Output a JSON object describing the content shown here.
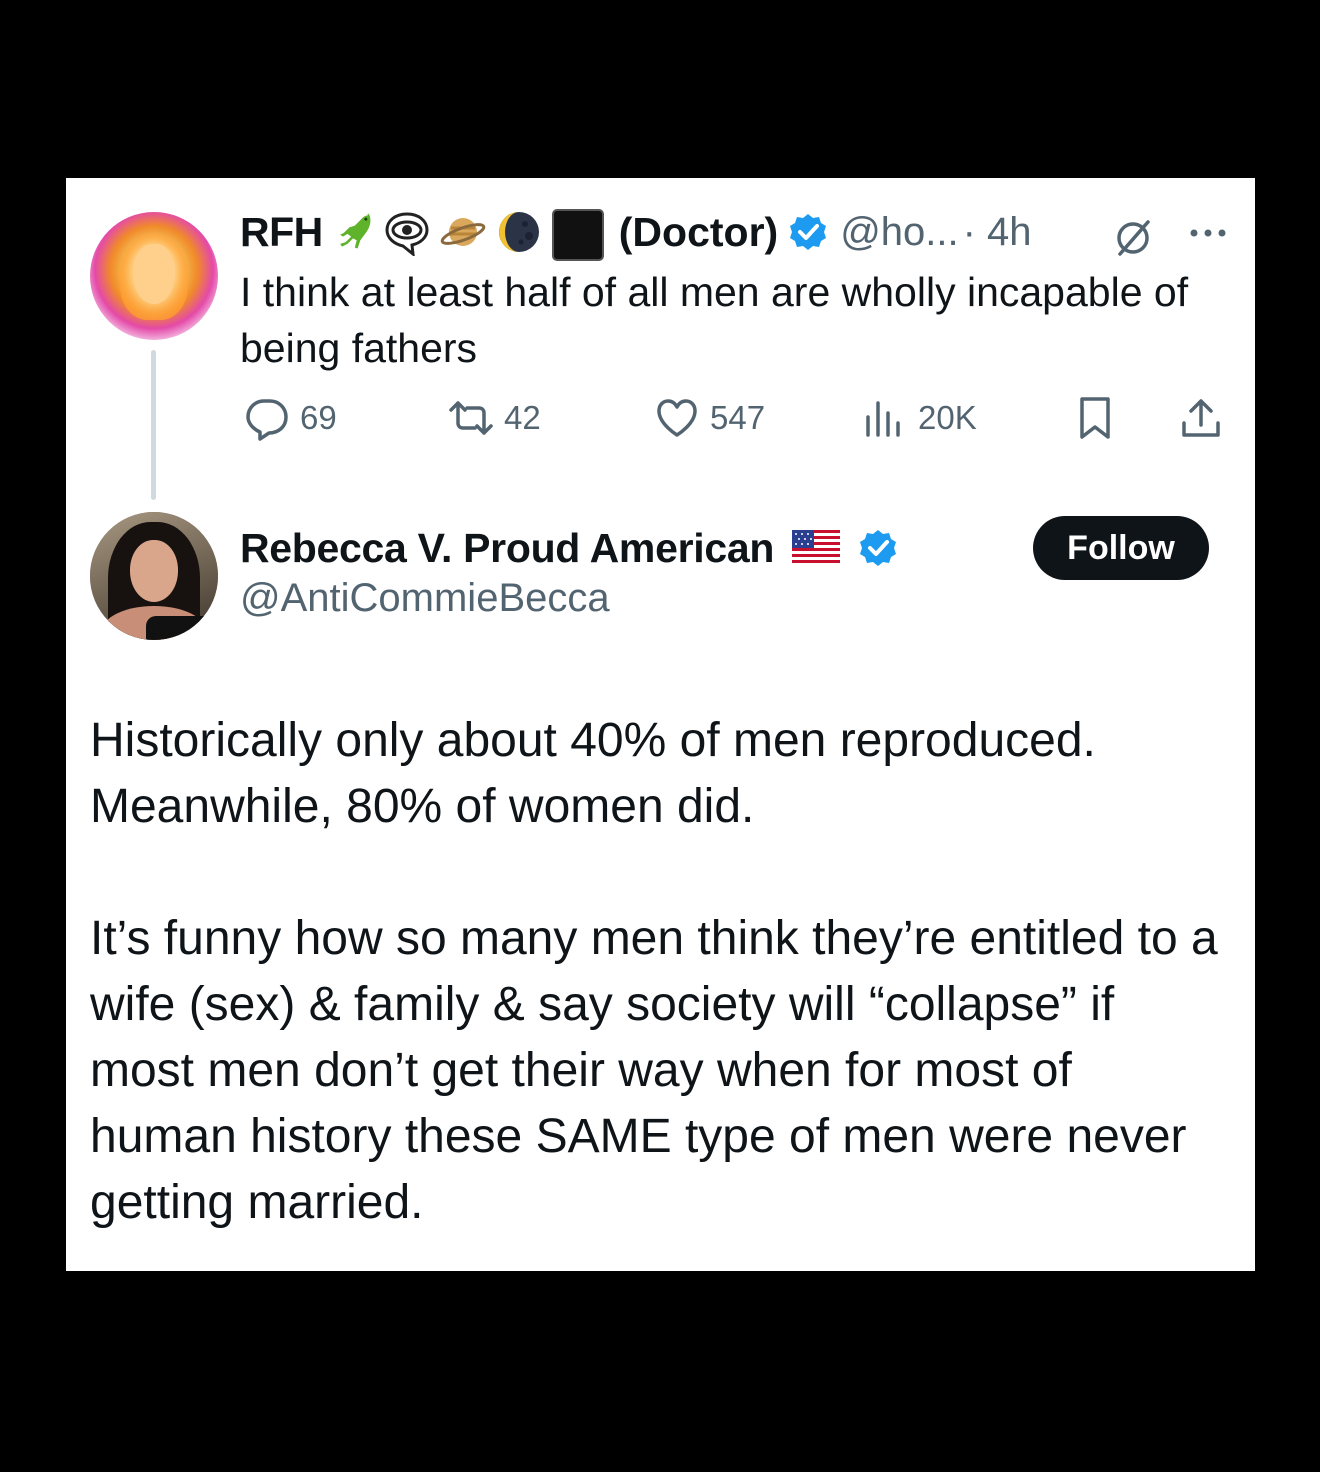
{
  "parent_tweet": {
    "display_name": "RFH",
    "emoji_icons": [
      "lizard-emoji",
      "eye-in-speech-bubble-emoji",
      "saturn-emoji",
      "moon-emoji",
      "black-square-emoji"
    ],
    "title_suffix": "(Doctor)",
    "handle": "@ho...",
    "time": "· 4h",
    "text": "I think at least half of all men are wholly incapable of being fathers",
    "stats": {
      "replies": "69",
      "retweets": "42",
      "likes": "547",
      "views": "20K"
    }
  },
  "main_tweet": {
    "display_name": "Rebecca V. Proud American",
    "handle": "@AntiCommieBecca",
    "follow_label": "Follow",
    "paragraphs": [
      "Historically only about 40% of men reproduced. Meanwhile, 80% of women did.",
      "It’s funny how so many men think they’re entitled to a wife (sex) & family & say society will “collapse” if most men don’t get their way when for most of human history these SAME type of men were never getting married."
    ]
  },
  "colors": {
    "verified_blue": "#1d9bf0",
    "secondary_text": "#536471",
    "primary_text": "#0f1419",
    "thread_line": "#cfd9de"
  }
}
